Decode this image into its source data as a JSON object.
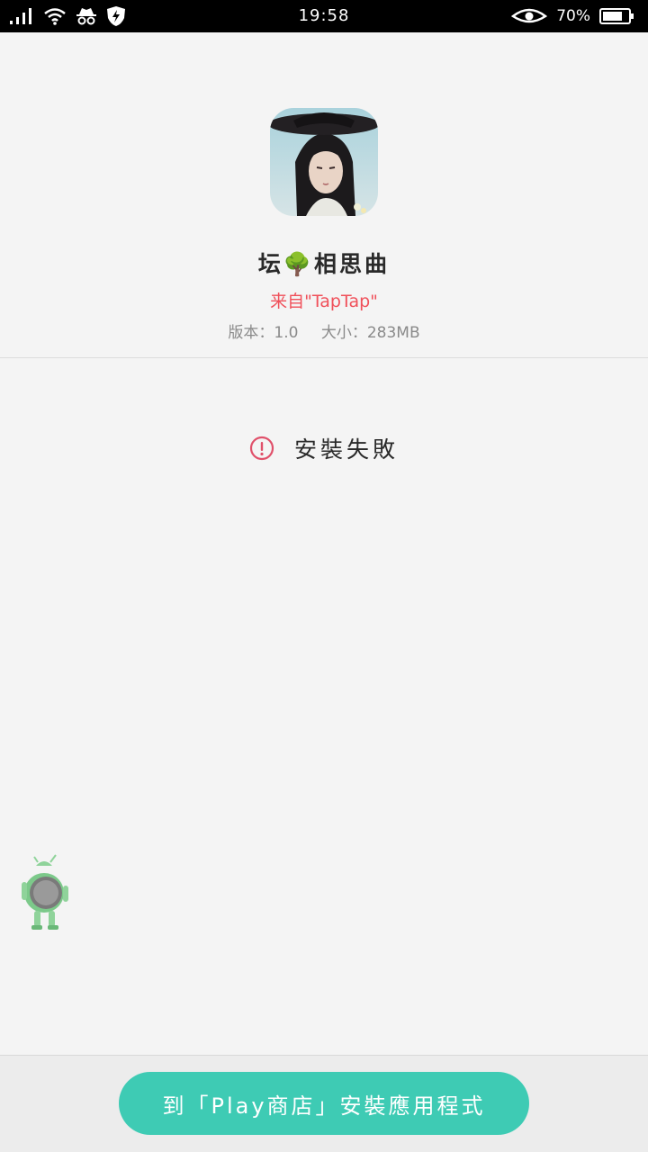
{
  "status_bar": {
    "time": "19:58",
    "battery": "70%",
    "icons": [
      "signal-icon",
      "wifi-icon",
      "incognito-icon",
      "shield-icon",
      "eye-icon",
      "battery-icon"
    ]
  },
  "app": {
    "name": "坛🌳相思曲",
    "source": "来自\"TapTap\"",
    "version": "版本：1.0",
    "size": "大小：283MB"
  },
  "result": {
    "status": "安裝失敗",
    "icon": "alert-circle-icon",
    "color": "#e0506a"
  },
  "action": {
    "button_label": "到「Play商店」安裝應用程式",
    "color": "#3ecbb4"
  }
}
